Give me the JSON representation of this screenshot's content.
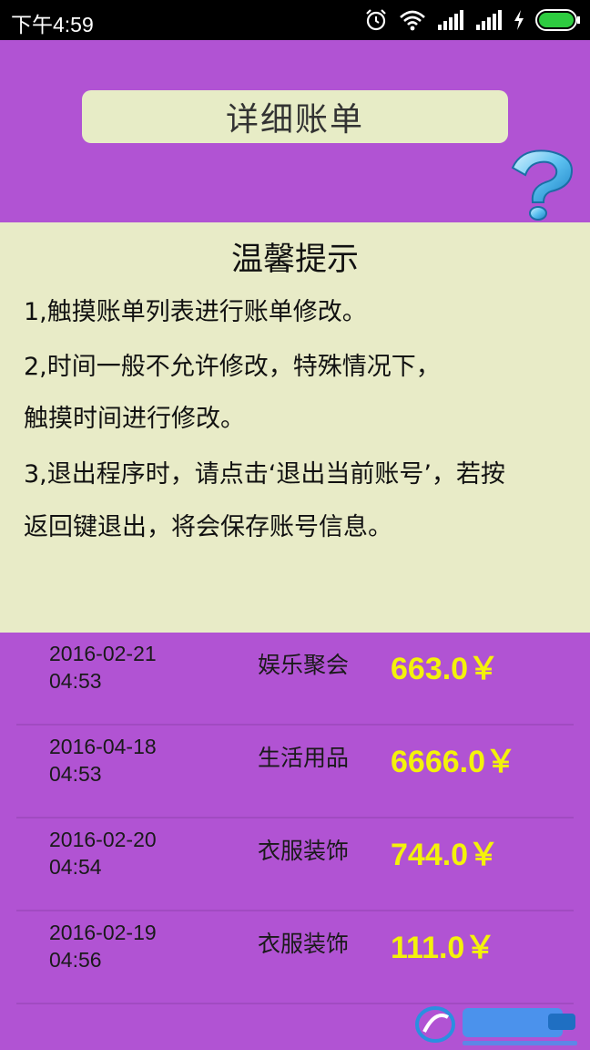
{
  "status_bar": {
    "time": "下午4:59",
    "icons": [
      "alarm-icon",
      "wifi-icon",
      "signal-icon",
      "signal-icon-2",
      "charging-icon",
      "battery-icon"
    ],
    "battery_color": "#2ecc40"
  },
  "header": {
    "title": "详细账单",
    "help_icon": "question-mark-icon"
  },
  "tips": {
    "title": "温馨提示",
    "lines": [
      "1,触摸账单列表进行账单修改。",
      "2,时间一般不允许修改，特殊情况下，",
      "触摸时间进行修改。",
      "3,退出程序时，请点击‘退出当前账号’，若按",
      "返回键退出，将会保存账号信息。"
    ]
  },
  "bills": [
    {
      "date": "2016-02-21",
      "time": "04:53",
      "category": "娱乐聚会",
      "amount": "663.0￥"
    },
    {
      "date": "2016-04-18",
      "time": "04:53",
      "category": "生活用品",
      "amount": "6666.0￥"
    },
    {
      "date": "2016-02-20",
      "time": "04:54",
      "category": "衣服装饰",
      "amount": "744.0￥"
    },
    {
      "date": "2016-02-19",
      "time": "04:56",
      "category": "衣服装饰",
      "amount": "111.0￥"
    }
  ],
  "colors": {
    "background": "#b153d3",
    "panel": "#e8ebc7",
    "amount": "#f4f20a"
  },
  "watermark": "watermark-logo"
}
